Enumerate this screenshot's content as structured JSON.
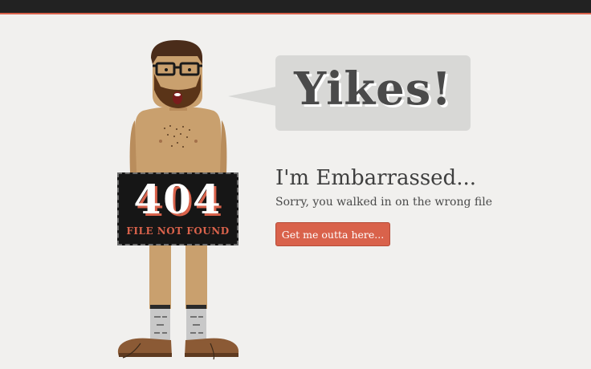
{
  "header": {
    "bg_color": "#222222",
    "accent_color": "#d9624b"
  },
  "speech_bubble": {
    "text": "Yikes!"
  },
  "sign": {
    "code": "404",
    "label": "FILE NOT FOUND"
  },
  "content": {
    "heading": "I'm Embarrassed...",
    "subtext": "Sorry, you walked in on the wrong file",
    "button_label": "Get me outta here..."
  },
  "illustration": {
    "icon": "embarrassed-man-illustration"
  }
}
